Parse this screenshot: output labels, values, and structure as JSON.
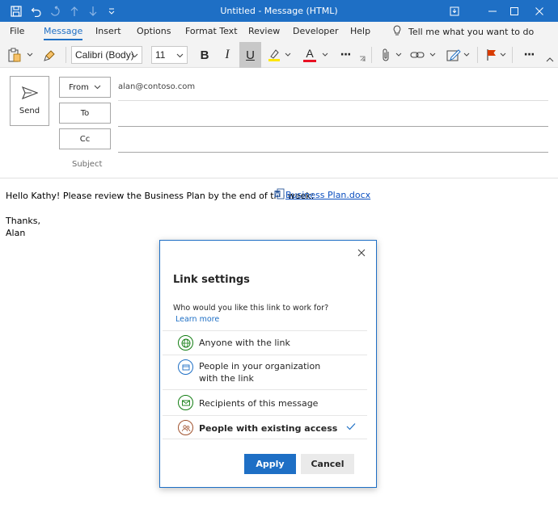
{
  "window": {
    "title": "Untitled  -  Message (HTML)"
  },
  "menu": {
    "tabs": [
      {
        "label": "File"
      },
      {
        "label": "Message"
      },
      {
        "label": "Insert"
      },
      {
        "label": "Options"
      },
      {
        "label": "Format Text"
      },
      {
        "label": "Review"
      },
      {
        "label": "Developer"
      },
      {
        "label": "Help"
      }
    ],
    "active_tab": "Message",
    "tell_me": "Tell me what you want to do"
  },
  "ribbon": {
    "font_name": "Calibri (Body)",
    "font_size": "11",
    "bold_label": "B",
    "italic_label": "I",
    "underline_label": "U",
    "font_color_label": "A",
    "more_label": "···",
    "highlight_color": "#ffe600",
    "font_color": "#e81123"
  },
  "header": {
    "send_label": "Send",
    "from_label": "From",
    "from_value": "alan@contoso.com",
    "to_label": "To",
    "cc_label": "Cc",
    "subject_label": "Subject"
  },
  "body": {
    "line1": "Hello Kathy! Please review the Business Plan by the end of the week:",
    "attachment": "Business Plan.docx",
    "line2": "Thanks,",
    "line3": "Alan"
  },
  "dialog": {
    "title": "Link settings",
    "question": "Who would you like this link to work for?",
    "learn_more": "Learn more",
    "options": [
      {
        "label": "Anyone with the link",
        "icon": "globe-icon"
      },
      {
        "label_line1": "People in your organization",
        "label_line2": "with the link",
        "icon": "building-icon"
      },
      {
        "label": "Recipients of this message",
        "icon": "mail-icon"
      },
      {
        "label": "People with existing access",
        "icon": "people-icon",
        "selected": true
      }
    ],
    "apply_label": "Apply",
    "cancel_label": "Cancel"
  },
  "colors": {
    "accent": "#1e6fc5",
    "titlebar": "#1e6fc5"
  }
}
